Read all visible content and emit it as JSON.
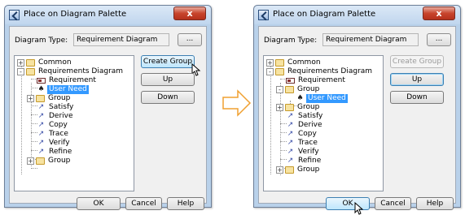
{
  "left_dialog": {
    "title": "Place on Diagram Palette",
    "close_label": "x",
    "diagram_type_label": "Diagram Type:",
    "diagram_type_value": "Requirement Diagram",
    "more_label": "...",
    "tree": [
      {
        "label": "Common",
        "icon": "folder-icon",
        "expander": "+"
      },
      {
        "label": "Requirements Diagram",
        "icon": "folder-icon",
        "expander": "-"
      },
      {
        "label": "Requirement",
        "icon": "requirement-icon"
      },
      {
        "label": "User Need",
        "icon": "actor-icon",
        "selected": true
      },
      {
        "label": "Group",
        "icon": "folder-icon",
        "expander": "+"
      },
      {
        "label": "Satisfy",
        "icon": "relationship-arrow-icon"
      },
      {
        "label": "Derive",
        "icon": "relationship-arrow-icon"
      },
      {
        "label": "Copy",
        "icon": "relationship-arrow-icon"
      },
      {
        "label": "Trace",
        "icon": "relationship-arrow-icon"
      },
      {
        "label": "Verify",
        "icon": "relationship-arrow-icon"
      },
      {
        "label": "Refine",
        "icon": "relationship-arrow-icon"
      },
      {
        "label": "Group",
        "icon": "folder-icon",
        "expander": "+"
      }
    ],
    "buttons": {
      "create_group": "Create Group",
      "up": "Up",
      "down": "Down",
      "ok": "OK",
      "cancel": "Cancel",
      "help": "Help"
    }
  },
  "right_dialog": {
    "title": "Place on Diagram Palette",
    "close_label": "x",
    "diagram_type_label": "Diagram Type:",
    "diagram_type_value": "Requirement Diagram",
    "more_label": "...",
    "tree": [
      {
        "label": "Common",
        "icon": "folder-icon",
        "expander": "+"
      },
      {
        "label": "Requirements Diagram",
        "icon": "folder-icon",
        "expander": "-"
      },
      {
        "label": "Requirement",
        "icon": "requirement-icon"
      },
      {
        "label": "Group",
        "icon": "folder-icon",
        "expander": "-"
      },
      {
        "label": "User Need",
        "icon": "actor-icon",
        "selected": true
      },
      {
        "label": "Group",
        "icon": "folder-icon",
        "expander": "+"
      },
      {
        "label": "Satisfy",
        "icon": "relationship-arrow-icon"
      },
      {
        "label": "Derive",
        "icon": "relationship-arrow-icon"
      },
      {
        "label": "Copy",
        "icon": "relationship-arrow-icon"
      },
      {
        "label": "Trace",
        "icon": "relationship-arrow-icon"
      },
      {
        "label": "Verify",
        "icon": "relationship-arrow-icon"
      },
      {
        "label": "Refine",
        "icon": "relationship-arrow-icon"
      },
      {
        "label": "Group",
        "icon": "folder-icon",
        "expander": "+"
      }
    ],
    "buttons": {
      "create_group": "Create Group",
      "up": "Up",
      "down": "Down",
      "ok": "OK",
      "cancel": "Cancel",
      "help": "Help"
    }
  },
  "transition_arrow": {
    "icon": "right-arrow-icon",
    "color": "#f0a030"
  },
  "colors": {
    "selection": "#3399ff",
    "titlebar": "#c0d6ee",
    "close": "#c7442c"
  }
}
